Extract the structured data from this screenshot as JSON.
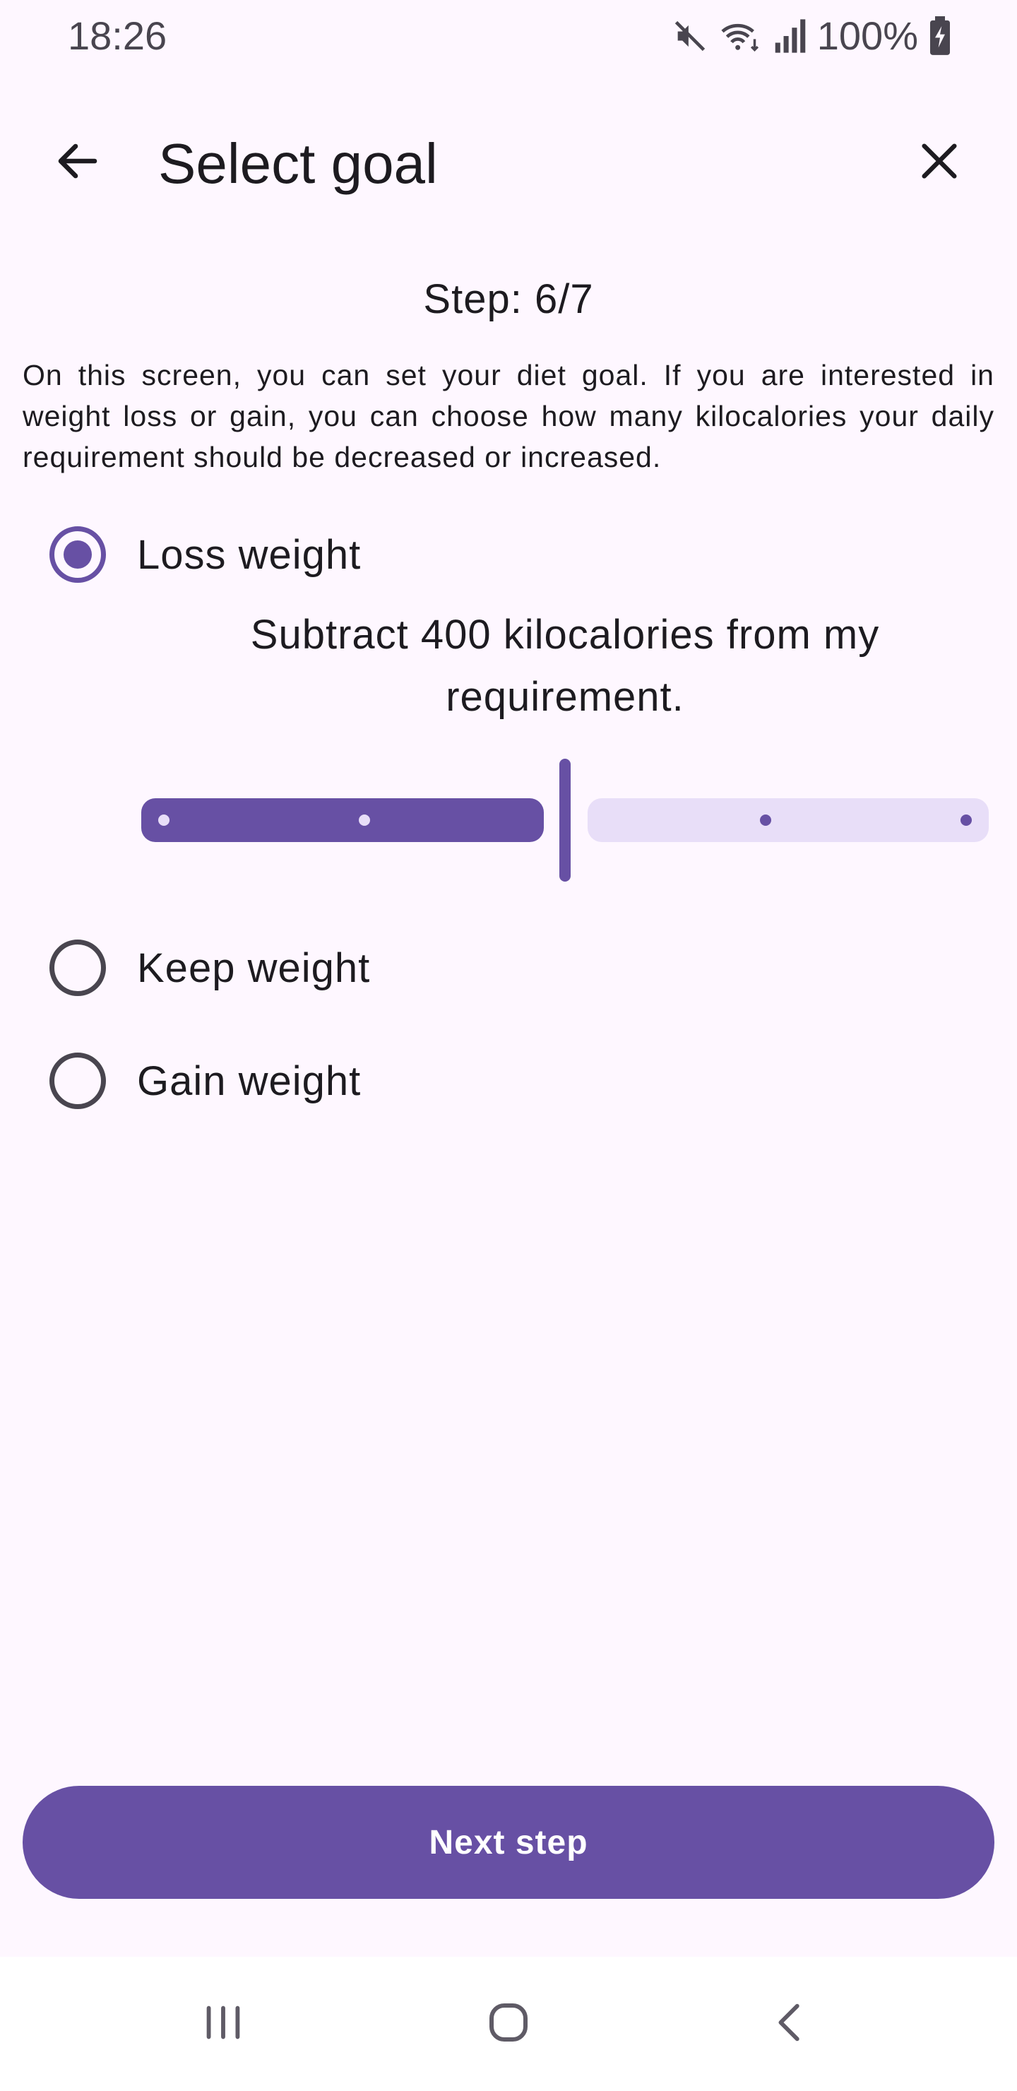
{
  "status_bar": {
    "time": "18:26",
    "battery": "100%",
    "icons": [
      "mute-icon",
      "wifi-icon",
      "signal-icon",
      "battery-charging-icon"
    ]
  },
  "app_bar": {
    "title": "Select goal",
    "back_icon": "arrow-back-icon",
    "close_icon": "close-icon"
  },
  "step": "Step: 6/7",
  "description": "On this screen, you can set your diet goal. If you are interested in weight loss or gain, you can choose how many kilocalories your daily requirement should be decreased or increased.",
  "options": [
    {
      "label": "Loss weight",
      "selected": true
    },
    {
      "label": "Keep weight",
      "selected": false
    },
    {
      "label": "Gain weight",
      "selected": false
    }
  ],
  "loss_detail": "Subtract 400 kilocalories from my requirement.",
  "slider": {
    "value": 400,
    "steps": [
      200,
      400,
      600,
      800
    ],
    "fraction": 0.5
  },
  "next_button": "Next step",
  "nav_bar": [
    "recent-apps-icon",
    "home-icon",
    "back-icon"
  ],
  "colors": {
    "primary": "#6750a4",
    "primary_container": "#e8def8",
    "background": "#fef7ff",
    "on_surface": "#1d1b20"
  }
}
